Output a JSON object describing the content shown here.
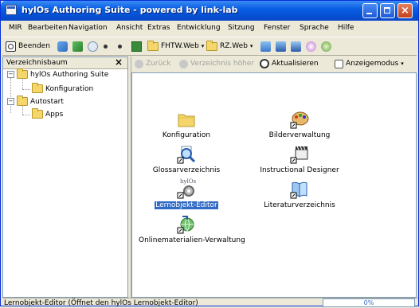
{
  "window": {
    "title": "hylOs Authoring Suite - powered by link-lab"
  },
  "menubar": [
    "MIR",
    "Bearbeiten",
    "Navigation",
    "Ansicht",
    "Extras",
    "Entwicklung",
    "Sitzung",
    "Fenster",
    "Sprache",
    "Hilfe"
  ],
  "toolbar": {
    "quit_label": "Beenden",
    "link1_label": "FHTW.Web",
    "link2_label": "RZ.Web"
  },
  "left_panel": {
    "title": "Verzeichnisbaum",
    "tree": [
      {
        "label": "hylOs Authoring Suite",
        "expander": "−"
      },
      {
        "label": "Konfiguration"
      },
      {
        "label": "Autostart",
        "expander": "−"
      },
      {
        "label": "Apps"
      }
    ]
  },
  "right_toolbar": {
    "back": "Zurück",
    "up": "Verzeichnis höher",
    "refresh": "Aktualisieren",
    "view_mode": "Anzeigemodus"
  },
  "items": [
    {
      "label": "Konfiguration",
      "icon": "folder-icon"
    },
    {
      "label": "Bilderverwaltung",
      "icon": "palette-icon"
    },
    {
      "label": "Glossarverzeichnis",
      "icon": "magnifier-icon"
    },
    {
      "label": "Instructional Designer",
      "icon": "clapperboard-icon"
    },
    {
      "label": "Lernobjekt-Editor",
      "icon": "gear-editor-icon",
      "selected": true,
      "badge": "hylOs"
    },
    {
      "label": "Literaturverzeichnis",
      "icon": "book-icon"
    },
    {
      "label": "Onlinematerialien-Verwaltung",
      "icon": "globe-icon"
    }
  ],
  "status": {
    "text": "Lernobjekt-Editor  (Öffnet den hylOs Lernobjekt-Editor)",
    "progress": "0%"
  },
  "colors": {
    "titlebar": "#0a5fe3",
    "selection": "#316ac5",
    "panel_bg": "#ece9d8"
  }
}
